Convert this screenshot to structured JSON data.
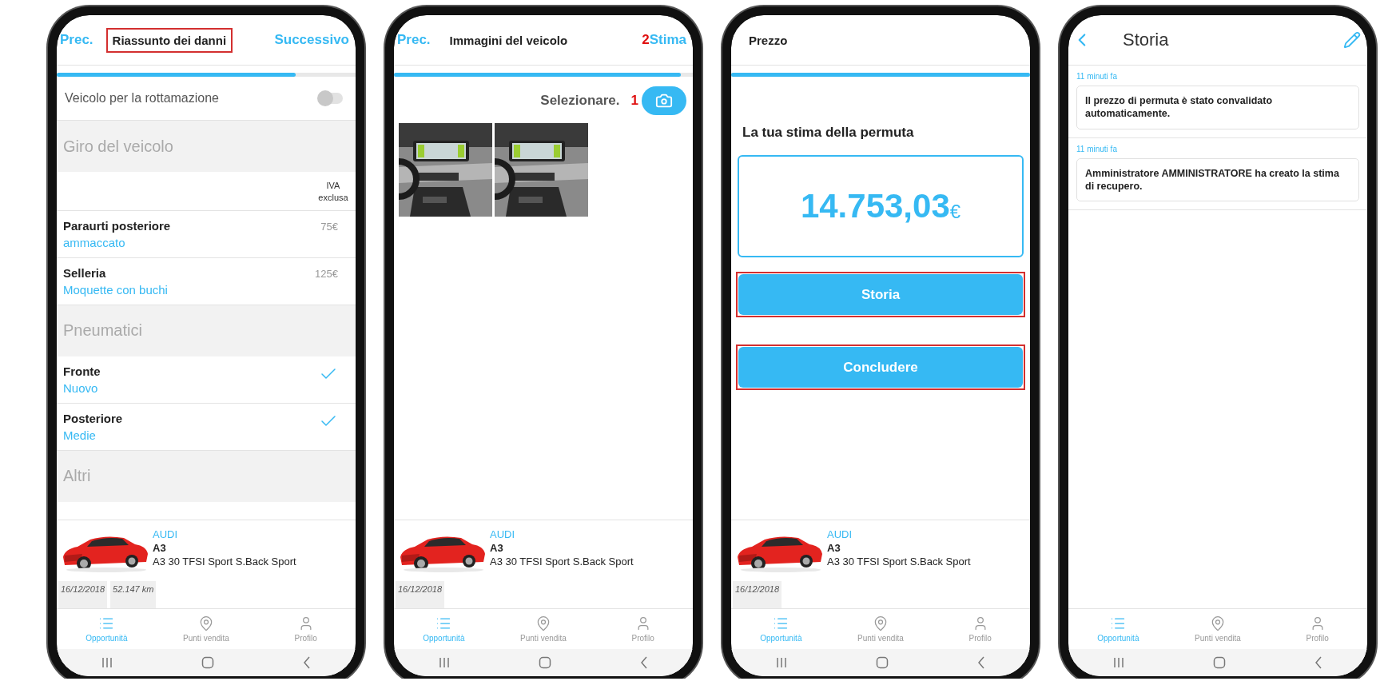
{
  "phones": [
    {
      "kind": "damage_summary",
      "header": {
        "prev": "Prec.",
        "title": "Riassunto dei danni",
        "title_annotated": true,
        "next": "Successivo"
      },
      "progress": {
        "level": 0.8
      },
      "scrap_toggle": {
        "label": "Veicolo per la rottamazione",
        "on": false
      },
      "sections": [
        {
          "title": "Giro del veicolo",
          "column_note": "IVA exclusa",
          "items": [
            {
              "kind": "price",
              "name": "Paraurti posteriore",
              "value": "ammaccato",
              "price": "75€"
            },
            {
              "kind": "price",
              "name": "Selleria",
              "value": "Moquette con buchi",
              "price": "125€"
            }
          ]
        },
        {
          "title": "Pneumatici",
          "items": [
            {
              "kind": "check",
              "name": "Fronte",
              "value": "Nuovo",
              "checked": true
            },
            {
              "kind": "check",
              "name": "Posteriore",
              "value": "Medie",
              "checked": true
            }
          ]
        },
        {
          "title": "Altri"
        }
      ],
      "vehicle": {
        "brand": "AUDI",
        "model": "A3",
        "version": "A3 30 TFSI Sport S.Back Sport",
        "chips": [
          "16/12/2018",
          "52.147 km"
        ]
      },
      "tab_bar": [
        {
          "label": "Opportunità",
          "selected": true
        },
        {
          "label": "Punti vendita",
          "selected": false
        },
        {
          "label": "Profilo",
          "selected": false
        }
      ]
    },
    {
      "kind": "vehicle_images",
      "header": {
        "prev": "Prec.",
        "title": "Immagini del veicolo",
        "next_marker": "2",
        "next": "Stima"
      },
      "progress": {
        "level": 0.96
      },
      "select": {
        "label": "Selezionare.",
        "marker": "1"
      },
      "photos": [
        {
          "kind": "picture"
        },
        {
          "kind": "picture"
        }
      ],
      "vehicle": {
        "brand": "AUDI",
        "model": "A3",
        "version": "A3 30 TFSI Sport S.Back Sport",
        "chips": [
          "16/12/2018"
        ]
      },
      "tab_bar": [
        {
          "label": "Opportunità",
          "selected": true
        },
        {
          "label": "Punti vendita",
          "selected": false
        },
        {
          "label": "Profilo",
          "selected": false
        }
      ]
    },
    {
      "kind": "price",
      "header": {
        "title": "Prezzo"
      },
      "progress": {
        "level": 1
      },
      "heading": "La tua stima della permuta",
      "price": {
        "amount": "14.753,03",
        "currency": "€"
      },
      "buttons": [
        {
          "label": "Storia",
          "annotated": true
        },
        {
          "label": "Concludere",
          "annotated": true
        }
      ],
      "vehicle": {
        "brand": "AUDI",
        "model": "A3",
        "version": "A3 30 TFSI Sport S.Back Sport",
        "chips": [
          "16/12/2018"
        ]
      },
      "tab_bar": [
        {
          "label": "Opportunità",
          "selected": true
        },
        {
          "label": "Punti vendita",
          "selected": false
        },
        {
          "label": "Profilo",
          "selected": false
        }
      ]
    },
    {
      "kind": "history",
      "header": {
        "title": "Storia"
      },
      "entries": [
        {
          "time": "11 minuti fa",
          "message": "Il prezzo di permuta è stato convalidato automaticamente."
        },
        {
          "time": "11 minuti fa",
          "message": "Amministratore AMMINISTRATORE ha creato la stima di recupero."
        }
      ],
      "tab_bar": [
        {
          "label": "Opportunità",
          "selected": true
        },
        {
          "label": "Punti vendita",
          "selected": false
        },
        {
          "label": "Profilo",
          "selected": false
        }
      ]
    }
  ]
}
